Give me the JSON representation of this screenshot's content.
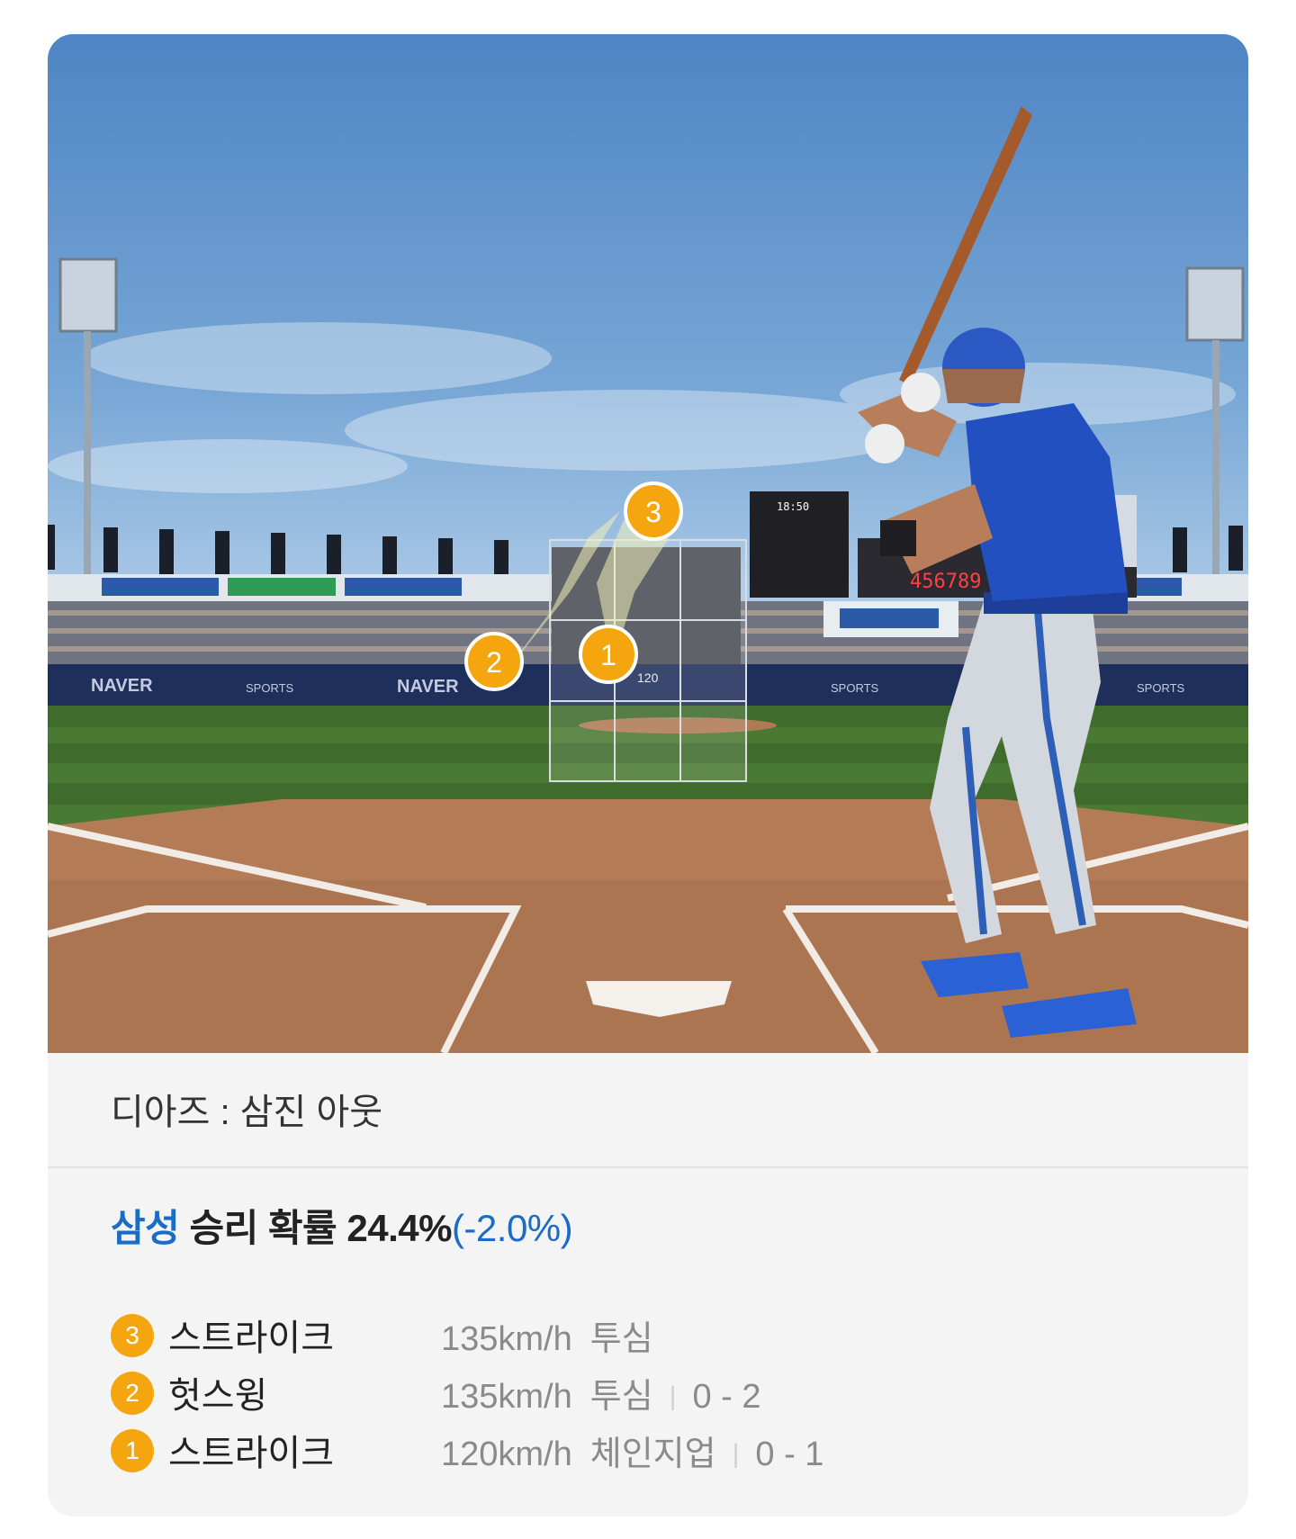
{
  "scene": {
    "zone_label": "120",
    "banner_brand": "NAVER",
    "banner_sports": "SPORTS",
    "scoreboard_time": "18:50",
    "markers": [
      "3",
      "2",
      "1"
    ]
  },
  "result": {
    "text": "디아즈 : 삼진 아웃"
  },
  "win_probability": {
    "team": "삼성",
    "label": " 승리 확률 24.4%",
    "delta": "(-2.0%)"
  },
  "pitches": [
    {
      "num": "3",
      "type": "스트라이크",
      "speed": "135km/h",
      "pitch": "투심",
      "sep": "",
      "count": ""
    },
    {
      "num": "2",
      "type": "헛스윙",
      "speed": "135km/h",
      "pitch": "투심",
      "sep": "|",
      "count": "0 - 2"
    },
    {
      "num": "1",
      "type": "스트라이크",
      "speed": "120km/h",
      "pitch": "체인지업",
      "sep": "|",
      "count": "0 - 1"
    }
  ],
  "colors": {
    "accent": "#1a6cc4",
    "badge": "#f5a60f",
    "card_bg": "#f4f4f4"
  }
}
